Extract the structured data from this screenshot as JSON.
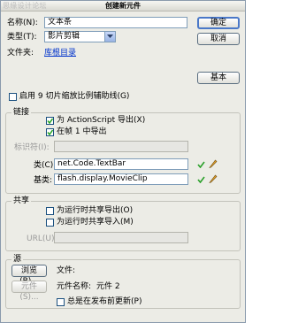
{
  "watermark": "思缘设计论坛",
  "dialog": {
    "title": "创建新元件",
    "name_label": "名称(N):",
    "name_value": "文本条",
    "type_label": "类型(T):",
    "type_value": "影片剪辑",
    "folder_label": "文件夹:",
    "folder_link": "库根目录",
    "ok_label": "确定",
    "cancel_label": "取消",
    "basic_label": "基本",
    "guides_label": "启用 9 切片缩放比例辅助线(G)"
  },
  "linkage": {
    "title": "链接",
    "export_as_label": "为 ActionScript 导出(X)",
    "export_frame_label": "在帧 1 中导出",
    "identifier_label": "标识符(I):",
    "class_label": "类(C):",
    "class_value": "net.Code.TextBar",
    "base_label": "基类:",
    "base_value": "flash.display.MovieClip"
  },
  "sharing": {
    "title": "共享",
    "export_runtime_label": "为运行时共享导出(O)",
    "import_runtime_label": "为运行时共享导入(M)",
    "url_label": "URL(U):"
  },
  "source": {
    "title": "源",
    "browse_label": "浏览(B)...",
    "symbol_label": "元件(S)...",
    "file_label": "文件:",
    "symbol_name_label": "元件名称:",
    "symbol_name_value": "元件 2",
    "always_update_label": "总是在发布前更新(P)"
  }
}
